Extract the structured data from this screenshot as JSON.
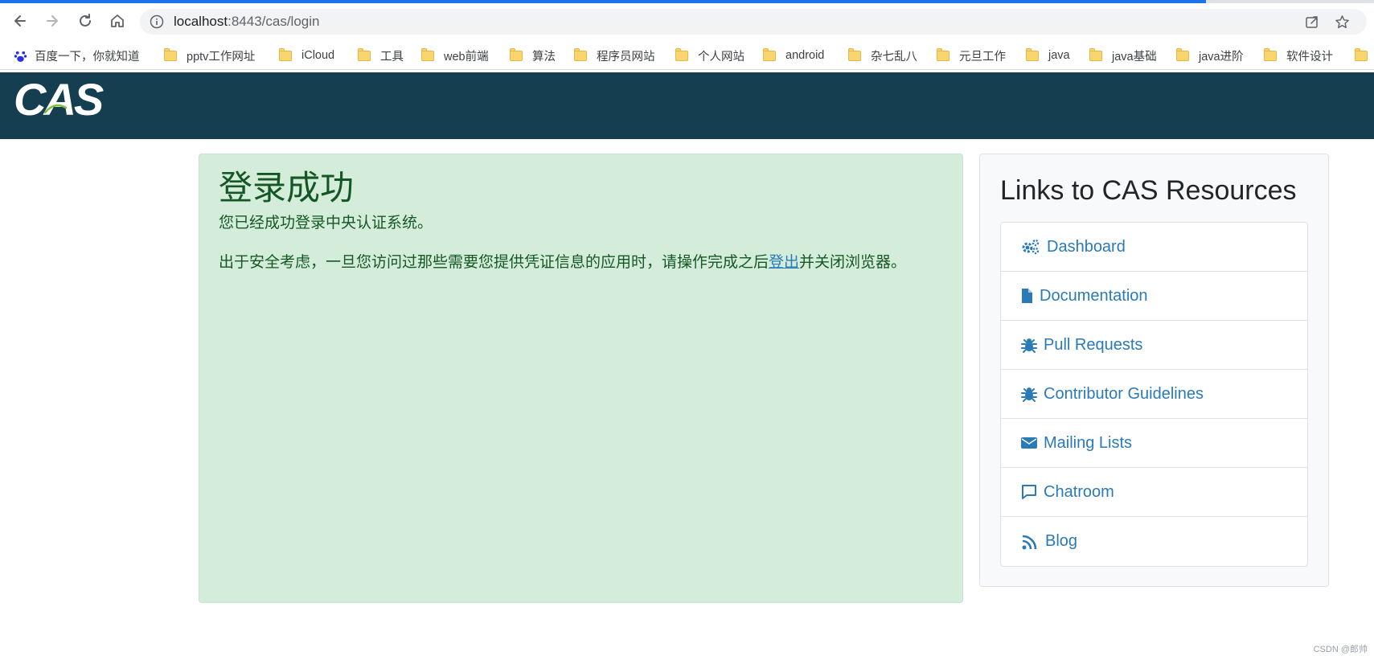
{
  "browser": {
    "url_host": "localhost",
    "url_rest": ":8443/cas/login",
    "bookmarks": [
      {
        "label": "百度一下，你就知道",
        "icon": "baidu-paw-icon"
      },
      {
        "label": "pptv工作网址",
        "icon": "folder-icon"
      },
      {
        "label": "iCloud",
        "icon": "folder-icon"
      },
      {
        "label": "工具",
        "icon": "folder-icon"
      },
      {
        "label": "web前端",
        "icon": "folder-icon"
      },
      {
        "label": "算法",
        "icon": "folder-icon"
      },
      {
        "label": "程序员网站",
        "icon": "folder-icon"
      },
      {
        "label": "个人网站",
        "icon": "folder-icon"
      },
      {
        "label": "android",
        "icon": "folder-icon"
      },
      {
        "label": "杂七乱八",
        "icon": "folder-icon"
      },
      {
        "label": "元旦工作",
        "icon": "folder-icon"
      },
      {
        "label": "java",
        "icon": "folder-icon"
      },
      {
        "label": "java基础",
        "icon": "folder-icon"
      },
      {
        "label": "java进阶",
        "icon": "folder-icon"
      },
      {
        "label": "软件设计",
        "icon": "folder-icon"
      }
    ]
  },
  "header": {
    "logo_text": "CAS",
    "bg_color": "#153e50"
  },
  "success": {
    "title": "登录成功",
    "line1": "您已经成功登录中央认证系统。",
    "line2_before": "出于安全考虑，一旦您访问过那些需要您提供凭证信息的应用时，请操作完成之后",
    "logout_link": "登出",
    "line2_after": "并关闭浏览器。"
  },
  "resources": {
    "title": "Links to CAS Resources",
    "links": [
      {
        "label": "Dashboard",
        "icon": "cogs-icon"
      },
      {
        "label": "Documentation",
        "icon": "file-icon"
      },
      {
        "label": "Pull Requests",
        "icon": "bug-icon"
      },
      {
        "label": "Contributor Guidelines",
        "icon": "bug-icon"
      },
      {
        "label": "Mailing Lists",
        "icon": "envelope-icon"
      },
      {
        "label": "Chatroom",
        "icon": "comment-icon"
      },
      {
        "label": "Blog",
        "icon": "rss-icon"
      }
    ]
  },
  "footer": {
    "credit": "CSDN @郎帅"
  },
  "colors": {
    "accent": "#2a7ab8",
    "success_bg": "#d4edda",
    "success_text": "#155724"
  }
}
